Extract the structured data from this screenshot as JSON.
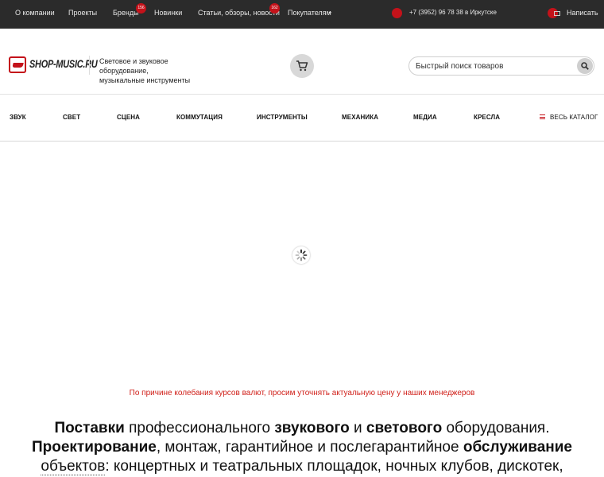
{
  "topbar": {
    "links": [
      "О компании",
      "Проекты",
      "Бренды",
      "Новинки",
      "Статьи, обзоры, новости",
      "Покупателям"
    ],
    "brands_badge": "156",
    "articles_badge": "162",
    "phone": "+7 (3952) 96 78 38 в Иркутске",
    "write": "Написать"
  },
  "header": {
    "logo_text": "SHOP-MUSIC.RU",
    "tagline_line1": "Световое и звуковое оборудование,",
    "tagline_line2": "музыкальные инструменты",
    "search_placeholder": "Быстрый поиск товаров"
  },
  "nav": {
    "items": [
      "ЗВУК",
      "СВЕТ",
      "СЦЕНА",
      "КОММУТАЦИЯ",
      "ИНСТРУМЕНТЫ",
      "МЕХАНИКА",
      "МЕДИА",
      "КРЕСЛА"
    ],
    "catalog": "ВЕСЬ КАТАЛОГ"
  },
  "notice": "По причине колебания курсов валют, просим уточнять актуальную цену у наших менеджеров",
  "headline": {
    "l1_b1": "Поставки",
    "l1_t1": " профессионального ",
    "l1_b2": "звукового",
    "l1_t2": " и ",
    "l1_b3": "светового",
    "l1_t3": " оборудования.",
    "l2_b1": "Проектирование",
    "l2_t1": ", монтаж, гарантийное и послегарантийное ",
    "l2_b2": "обслуживание",
    "l3_u": "объектов",
    "l3_t": ": концертных и театральных площадок, ночных клубов, дискотек,"
  },
  "colors": {
    "accent": "#c4121a",
    "topbar_bg": "#2b2b2b",
    "notice": "#d0201a"
  },
  "icons": [
    "cart-icon",
    "search-icon",
    "phone-icon",
    "mail-icon",
    "menu-icon",
    "loader-icon",
    "chevron-down-icon"
  ]
}
